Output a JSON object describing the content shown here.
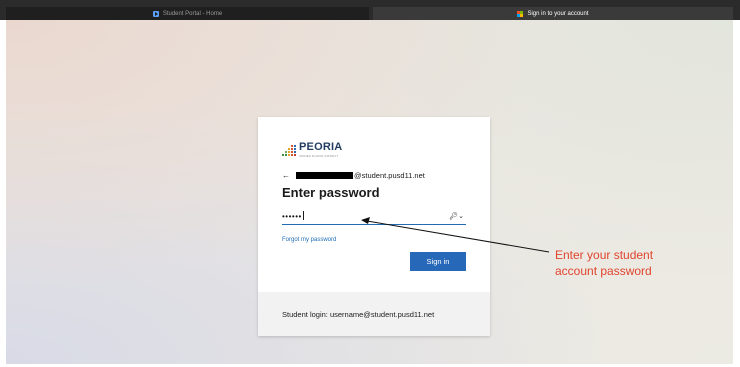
{
  "tabs": [
    {
      "label": "Student Portal - Home",
      "icon": "portal-icon",
      "active": false
    },
    {
      "label": "Sign in to your account",
      "icon": "microsoft-logo-icon",
      "active": true
    }
  ],
  "ms_logo_colors": [
    "#f25022",
    "#7fba00",
    "#00a4ef",
    "#ffb900"
  ],
  "card": {
    "logo_text": "PEORIA",
    "logo_subtext": "UNIFIED SCHOOL DISTRICT",
    "back_icon": "back-arrow-icon",
    "email_suffix": "@student.pusd11.net",
    "heading": "Enter password",
    "password_mask": "••••••",
    "reveal_icon": "key-icon",
    "forgot_link": "Forgot my password",
    "sign_in_label": "Sign in",
    "footer_text": "Student login: username@student.pusd11.net"
  },
  "annotation": {
    "text_line1": "Enter your student",
    "text_line2": "account password",
    "color": "#e0442e"
  },
  "colors": {
    "accent": "#2868b8",
    "link": "#1f6cb5",
    "logo_dark": "#1f3b5f"
  }
}
